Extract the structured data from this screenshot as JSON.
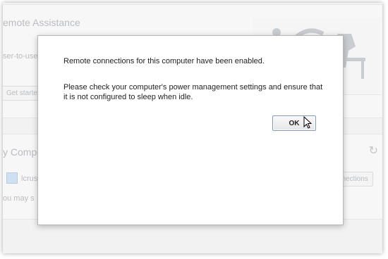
{
  "background": {
    "assistance_title": "emote Assistance",
    "assistance_desc": "ser-to-use",
    "get_started_label": "Get starte",
    "computers_title": "y Comp",
    "computer_name": "lcrus",
    "computers_note": "ou may s",
    "connections_button": "nnections",
    "illustration_icon": "person-at-desk-illustration",
    "refresh_icon": "refresh-icon"
  },
  "dialog": {
    "message": "Remote connections for this computer have been enabled.",
    "detail": "Please check your computer's power management settings and ensure that it is not configured to sleep when idle.",
    "ok_label": "OK"
  }
}
